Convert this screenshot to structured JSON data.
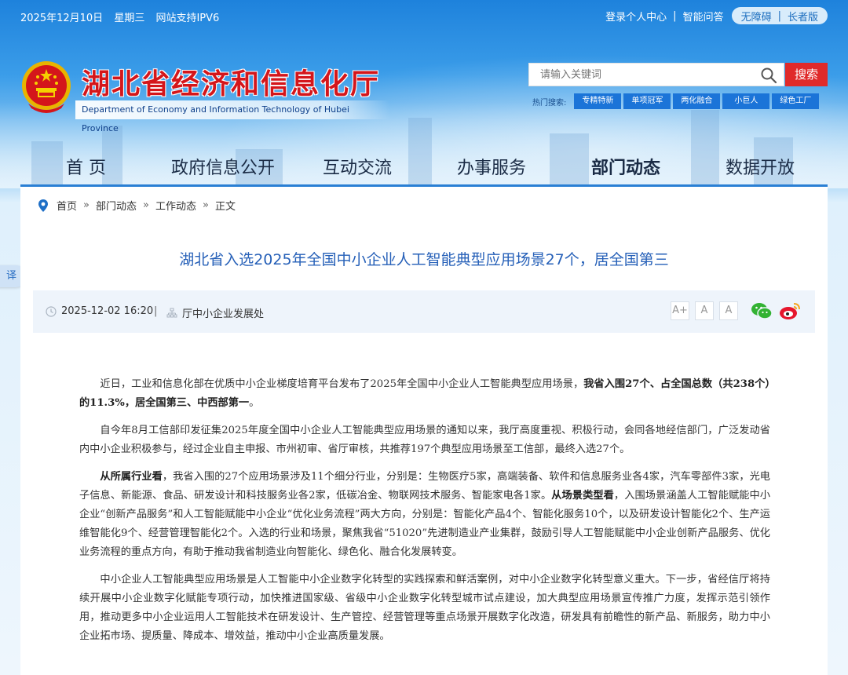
{
  "topbar": {
    "date": "2025年12月10日",
    "weekday": "星期三",
    "ipv6": "网站支持IPV6",
    "login": "登录个人中心",
    "qa": "智能问答",
    "accessible": "无障碍",
    "elder": "长者版"
  },
  "logo": {
    "title": "湖北省经济和信息化厅",
    "subtitle": "Department of Economy and Information Technology of Hubei Province"
  },
  "search": {
    "placeholder": "请输入关键词",
    "button": "搜索",
    "hot_label": "热门搜索:",
    "hot_tags": [
      "专精特新",
      "单项冠军",
      "两化融合",
      "小巨人",
      "绿色工厂"
    ]
  },
  "nav": [
    "首 页",
    "政府信息公开",
    "互动交流",
    "办事服务",
    "部门动态",
    "数据开放"
  ],
  "nav_active": "部门动态",
  "breadcrumb": [
    "首页",
    "部门动态",
    "工作动态",
    "正文"
  ],
  "breadcrumb_sep": "»",
  "translate": "译",
  "article": {
    "title": "湖北省入选2025年全国中小企业人工智能典型应用场景27个，居全国第三",
    "datetime": "2025-12-02 16:20",
    "department": "厅中小企业发展处",
    "font_sizes": [
      "A+",
      "A",
      "A"
    ],
    "p1_a": "近日，工业和信息化部在优质中小企业梯度培育平台发布了2025年全国中小企业人工智能典型应用场景，",
    "p1_b": "我省入围27个、占全国总数（共238个）的11.3%，居全国第三、中西部第一",
    "p1_c": "。",
    "p2": "自今年8月工信部印发征集2025年度全国中小企业人工智能典型应用场景的通知以来，我厅高度重视、积极行动，会同各地经信部门，广泛发动省内中小企业积极参与，经过企业自主申报、市州初审、省厅审核，共推荐197个典型应用场景至工信部，最终入选27个。",
    "p3_a": "从所属行业看",
    "p3_b": "，我省入围的27个应用场景涉及11个细分行业，分别是：生物医疗5家，高端装备、软件和信息服务业各4家，汽车零部件3家，光电子信息、新能源、食品、研发设计和科技服务业各2家，低碳冶金、物联网技术服务、智能家电各1家。",
    "p3_c": "从场景类型看",
    "p3_d": "，入围场景涵盖人工智能赋能中小企业“创新产品服务”和人工智能赋能中小企业“优化业务流程”两大方向，分别是：智能化产品4个、智能化服务10个，以及研发设计智能化2个、生产运维智能化9个、经营管理智能化2个。入选的行业和场景，聚焦我省“51020”先进制造业产业集群，鼓励引导人工智能赋能中小企业创新产品服务、优化业务流程的重点方向，有助于推动我省制造业向智能化、绿色化、融合化发展转变。",
    "p4": "中小企业人工智能典型应用场景是人工智能中小企业数字化转型的实践探索和鲜活案例，对中小企业数字化转型意义重大。下一步，省经信厅将持续开展中小企业数字化赋能专项行动，加快推进国家级、省级中小企业数字化转型城市试点建设，加大典型应用场景宣传推广力度，发挥示范引领作用，推动更多中小企业运用人工智能技术在研发设计、生产管控、经营管理等重点场景开展数字化改造，研发具有前瞻性的新产品、新服务，助力中小企业拓市场、提质量、降成本、增效益，推动中小企业高质量发展。"
  },
  "colors": {
    "title_red": "#d4161b",
    "article_title_blue": "#2660b8",
    "search_red": "#e02a2a",
    "tag_blue": "#1b74d8"
  },
  "icons": [
    "search-icon",
    "location-pin-icon",
    "clock-icon",
    "org-icon",
    "wechat-icon",
    "weibo-icon",
    "national-emblem-icon"
  ]
}
